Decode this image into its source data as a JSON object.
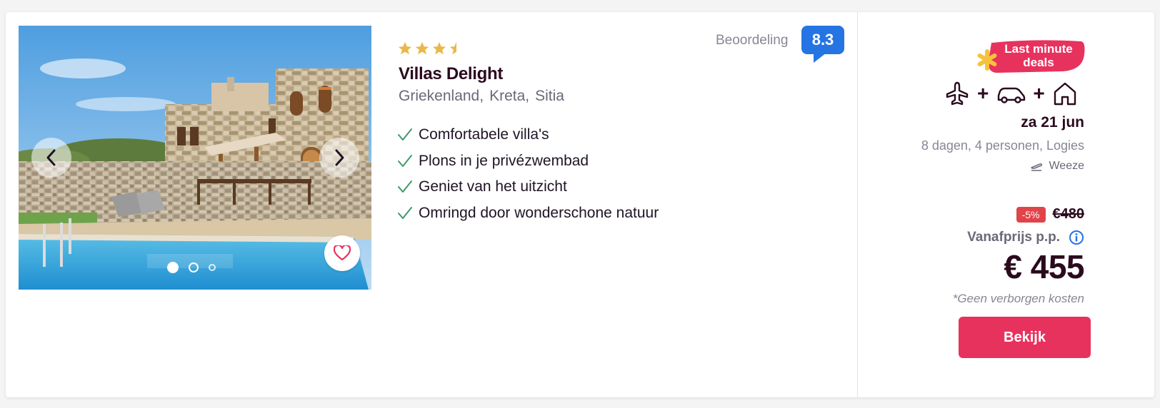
{
  "hotel": {
    "stars": 3.5,
    "name": "Villas Delight",
    "location": [
      "Griekenland,",
      "Kreta,",
      "Sitia"
    ],
    "features": [
      "Comfortabele villa's",
      "Plons in je privézwembad",
      "Geniet van het uitzicht",
      "Omringd door wonderschone natuur"
    ],
    "rating_label": "Beoordeling",
    "rating_value": "8.3"
  },
  "carousel": {
    "total_images": 3,
    "active_index": 0
  },
  "offer": {
    "deal_badge": "Last minute deals",
    "transport_icons": [
      "plane-icon",
      "car-icon",
      "house-icon"
    ],
    "date": "za 21 jun",
    "trip_info": "8 dagen, 4 personen, Logies",
    "airport": "Weeze",
    "discount": "-5%",
    "old_price": "€480",
    "from_label": "Vanafprijs p.p.",
    "price": "€ 455",
    "no_hidden_costs": "*Geen verborgen kosten",
    "cta_label": "Bekijk"
  },
  "colors": {
    "title": "#2b0a1e",
    "rating_badge": "#2574e4",
    "cta": "#e8325e",
    "discount": "#e04449",
    "star": "#e8b84a",
    "check": "#3e9a6a",
    "deal_badge_bg": "#e8325e",
    "deal_badge_star": "#f6c23c"
  }
}
